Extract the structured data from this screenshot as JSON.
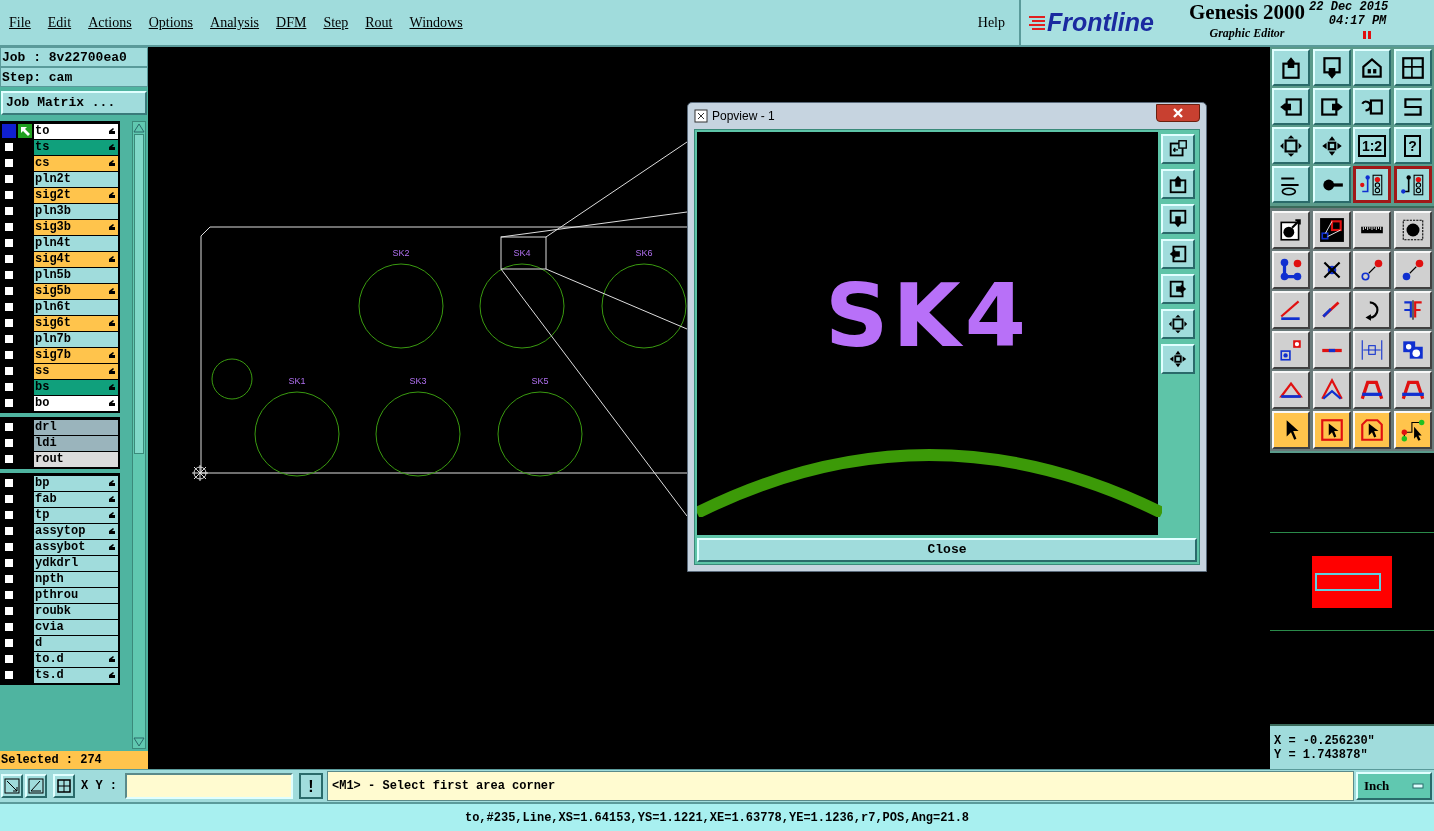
{
  "menu": [
    {
      "label": "File"
    },
    {
      "label": "Edit"
    },
    {
      "label": "Actions"
    },
    {
      "label": "Options"
    },
    {
      "label": "Analysis"
    },
    {
      "label": "DFM"
    },
    {
      "label": "Step"
    },
    {
      "label": "Rout"
    },
    {
      "label": "Windows"
    }
  ],
  "help": "Help",
  "brand": {
    "logo": "Frontline",
    "product": "Genesis 2000",
    "subtitle": "Graphic Editor",
    "date": "22 Dec 2015",
    "time": "04:17 PM"
  },
  "job": "Job : 8v22700ea0",
  "step": "Step: cam",
  "job_matrix_button": "Job Matrix ...",
  "layer_groups": [
    {
      "layers": [
        {
          "name": "to",
          "color": "#ffffff",
          "marked": true,
          "selected": true
        },
        {
          "name": "ts",
          "color": "#10a07c",
          "marked": true,
          "selected": false
        },
        {
          "name": "cs",
          "color": "#ffc44c",
          "marked": true,
          "selected": false
        },
        {
          "name": "pln2t",
          "color": "#a0dcdc",
          "marked": false,
          "selected": false
        },
        {
          "name": "sig2t",
          "color": "#ffc44c",
          "marked": true,
          "selected": false
        },
        {
          "name": "pln3b",
          "color": "#a0dcdc",
          "marked": false,
          "selected": false
        },
        {
          "name": "sig3b",
          "color": "#ffc44c",
          "marked": true,
          "selected": false
        },
        {
          "name": "pln4t",
          "color": "#a0dcdc",
          "marked": false,
          "selected": false
        },
        {
          "name": "sig4t",
          "color": "#ffc44c",
          "marked": true,
          "selected": false
        },
        {
          "name": "pln5b",
          "color": "#a0dcdc",
          "marked": false,
          "selected": false
        },
        {
          "name": "sig5b",
          "color": "#ffc44c",
          "marked": true,
          "selected": false
        },
        {
          "name": "pln6t",
          "color": "#a0dcdc",
          "marked": false,
          "selected": false
        },
        {
          "name": "sig6t",
          "color": "#ffc44c",
          "marked": true,
          "selected": false
        },
        {
          "name": "pln7b",
          "color": "#a0dcdc",
          "marked": false,
          "selected": false
        },
        {
          "name": "sig7b",
          "color": "#ffc44c",
          "marked": true,
          "selected": false
        },
        {
          "name": "ss",
          "color": "#ffc44c",
          "marked": true,
          "selected": false
        },
        {
          "name": "bs",
          "color": "#10a07c",
          "marked": true,
          "selected": false
        },
        {
          "name": "bo",
          "color": "#ffffff",
          "marked": true,
          "selected": false
        }
      ]
    },
    {
      "layers": [
        {
          "name": "drl",
          "color": "#9ab4bc",
          "marked": false,
          "selected": false
        },
        {
          "name": "ldi",
          "color": "#9ab4bc",
          "marked": false,
          "selected": false
        },
        {
          "name": "rout",
          "color": "#dcdcdc",
          "marked": false,
          "selected": false
        }
      ]
    },
    {
      "layers": [
        {
          "name": "bp",
          "color": "#a0dcdc",
          "marked": true,
          "selected": false
        },
        {
          "name": "fab",
          "color": "#a0dcdc",
          "marked": true,
          "selected": false
        },
        {
          "name": "tp",
          "color": "#a0dcdc",
          "marked": true,
          "selected": false
        },
        {
          "name": "assytop",
          "color": "#a0dcdc",
          "marked": true,
          "selected": false
        },
        {
          "name": "assybot",
          "color": "#a0dcdc",
          "marked": true,
          "selected": false
        },
        {
          "name": "ydkdrl",
          "color": "#a0dcdc",
          "marked": false,
          "selected": false
        },
        {
          "name": "npth",
          "color": "#a0dcdc",
          "marked": false,
          "selected": false
        },
        {
          "name": "pthrou",
          "color": "#a0dcdc",
          "marked": false,
          "selected": false
        },
        {
          "name": "roubk",
          "color": "#a0dcdc",
          "marked": false,
          "selected": false
        },
        {
          "name": "cvia",
          "color": "#a0dcdc",
          "marked": false,
          "selected": false
        },
        {
          "name": "d",
          "color": "#a0dcdc",
          "marked": false,
          "selected": false
        },
        {
          "name": "to.d",
          "color": "#a0dcdc",
          "marked": true,
          "selected": false
        },
        {
          "name": "ts.d",
          "color": "#a0dcdc",
          "marked": true,
          "selected": false
        }
      ]
    }
  ],
  "selected_count": "Selected : 274",
  "canvas": {
    "labels": [
      {
        "text": "SK2"
      },
      {
        "text": "SK4"
      },
      {
        "text": "SK6"
      },
      {
        "text": "SK1"
      },
      {
        "text": "SK3"
      },
      {
        "text": "SK5"
      }
    ]
  },
  "popview": {
    "title": "Popview - 1",
    "label": "SK4",
    "close": "Close"
  },
  "view_tools": [
    {
      "kind": "icon",
      "pressed": false
    },
    {
      "kind": "icon",
      "pressed": false
    },
    {
      "kind": "icon",
      "pressed": false
    },
    {
      "kind": "icon",
      "pressed": false
    },
    {
      "kind": "icon",
      "pressed": false
    },
    {
      "kind": "icon",
      "pressed": false
    },
    {
      "kind": "icon",
      "pressed": false
    },
    {
      "kind": "icon",
      "pressed": false
    },
    {
      "kind": "icon",
      "pressed": false
    },
    {
      "kind": "icon",
      "pressed": false
    },
    {
      "kind": "text",
      "label": "1:2",
      "pressed": false
    },
    {
      "kind": "text",
      "label": "?",
      "pressed": false
    },
    {
      "kind": "icon",
      "pressed": false
    },
    {
      "kind": "icon",
      "pressed": false
    },
    {
      "kind": "icon",
      "pressed": true
    },
    {
      "kind": "icon",
      "pressed": true
    }
  ],
  "edit_tools": [
    {
      "highlighted": false
    },
    {
      "highlighted": false
    },
    {
      "highlighted": false
    },
    {
      "highlighted": false
    },
    {
      "highlighted": false
    },
    {
      "highlighted": false
    },
    {
      "highlighted": false
    },
    {
      "highlighted": false
    },
    {
      "highlighted": false
    },
    {
      "highlighted": false
    },
    {
      "highlighted": false
    },
    {
      "highlighted": false
    },
    {
      "highlighted": false
    },
    {
      "highlighted": false
    },
    {
      "highlighted": false
    },
    {
      "highlighted": false
    },
    {
      "highlighted": false
    },
    {
      "highlighted": false
    },
    {
      "highlighted": false
    },
    {
      "highlighted": false
    },
    {
      "highlighted": true
    },
    {
      "highlighted": true
    },
    {
      "highlighted": true
    },
    {
      "highlighted": true
    }
  ],
  "coordinates": {
    "x": "X = -0.256230\"",
    "y": "Y = 1.743878\""
  },
  "xy_label": "X Y :",
  "alert_button": "!",
  "prompt": "<M1> - Select first area corner",
  "units": "Inch",
  "status": "to,#235,Line,XS=1.64153,YS=1.1221,XE=1.63778,YE=1.1236,r7,POS,Ang=21.8"
}
